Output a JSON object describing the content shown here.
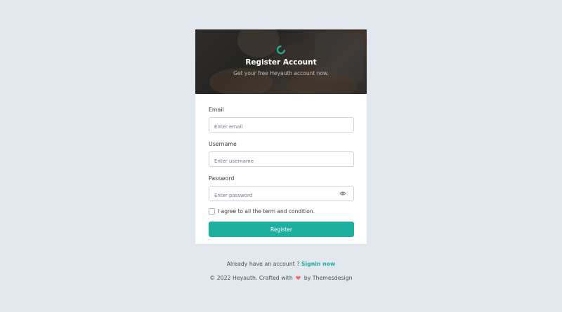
{
  "header": {
    "title": "Register Account",
    "subtitle": "Get your free Heyauth account now."
  },
  "form": {
    "email": {
      "label": "Email",
      "placeholder": "Enter email",
      "value": ""
    },
    "username": {
      "label": "Username",
      "placeholder": "Enter username",
      "value": ""
    },
    "password": {
      "label": "Password",
      "placeholder": "Enter password",
      "value": ""
    },
    "agree_text": "I agree to all the term and condition.",
    "agree_checked": false,
    "submit_label": "Register"
  },
  "footer": {
    "signin_prompt": "Already have an account ?",
    "signin_link": "Signin now",
    "copyright_prefix": "© 2022 Heyauth. Crafted with",
    "copyright_suffix": "by Themesdesign"
  },
  "colors": {
    "accent": "#1faf9f",
    "heart": "#f46a6a",
    "page_bg": "#e3e7ee"
  },
  "icons": {
    "logo": "logo-ring-icon",
    "password_toggle": "eye-icon",
    "heart": "heart-icon"
  }
}
